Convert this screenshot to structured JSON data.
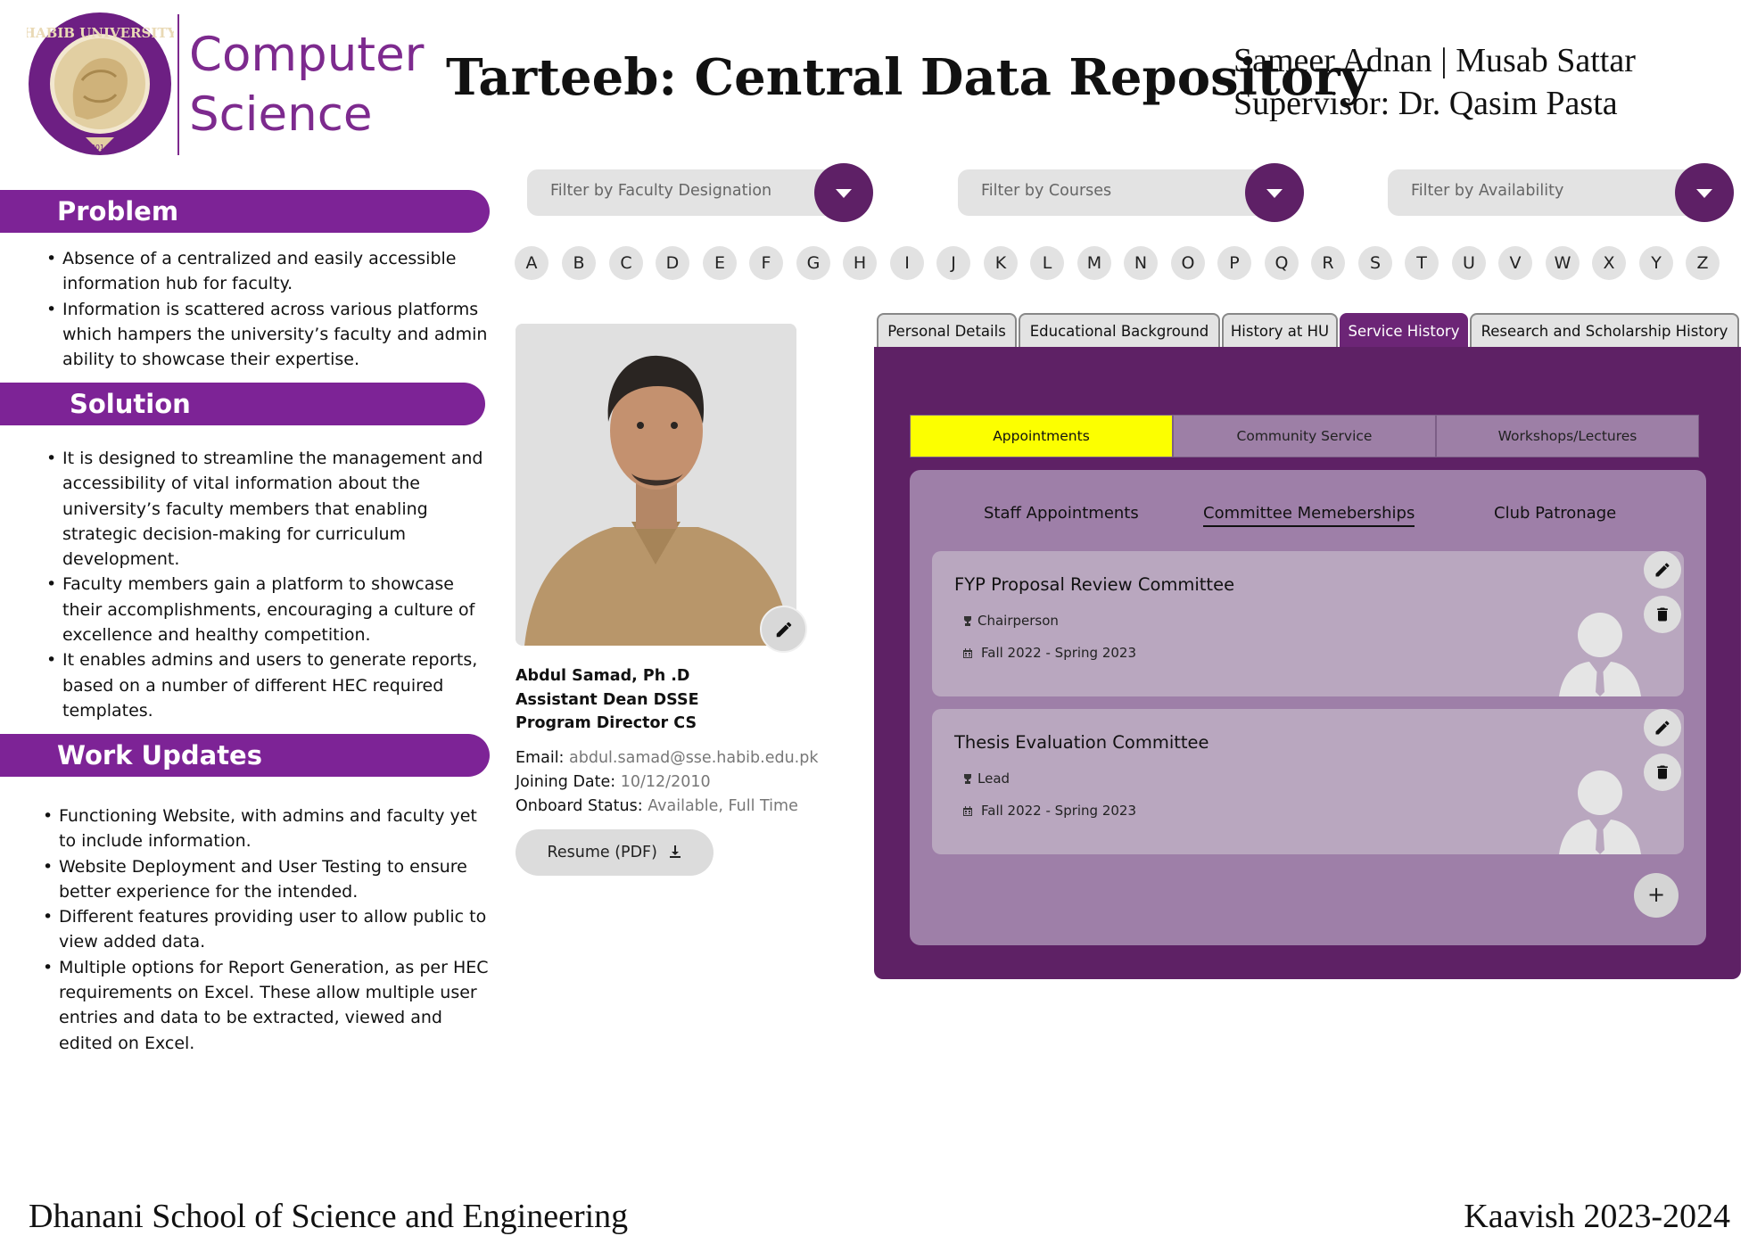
{
  "header": {
    "logo_text": "HABIB UNIVERSITY",
    "logo_year": "2014",
    "department_line1": "Computer",
    "department_line2": "Science",
    "title": "Tarteeb: Central Data Repository",
    "authors": "Sameer Adnan | Musab Sattar",
    "supervisor": "Supervisor: Dr. Qasim Pasta"
  },
  "sections": {
    "problem": {
      "title": "Problem",
      "bullets": [
        "Absence of a centralized and easily accessible information hub for faculty.",
        "Information is scattered across various platforms which hampers the university’s faculty and admin ability to showcase their expertise."
      ]
    },
    "solution": {
      "title": "Solution",
      "bullets": [
        "It is designed to streamline the management and accessibility of vital information about the university’s faculty members that enabling strategic decision-making for curriculum development.",
        "Faculty members gain a platform to showcase their accomplishments, encouraging a culture of excellence and healthy competition.",
        "It enables admins and users to generate reports, based on a number of different HEC required templates."
      ]
    },
    "work_updates": {
      "title": "Work Updates",
      "bullets": [
        "Functioning Website, with admins and faculty yet to include information.",
        "Website Deployment and User Testing to ensure better experience for the intended.",
        "Different features providing user to allow public to view added data.",
        "Multiple options for Report Generation, as per HEC requirements on Excel. These allow multiple user entries and data to be extracted, viewed and edited on Excel."
      ]
    }
  },
  "filters": {
    "designation": "Filter by Faculty Designation",
    "courses": "Filter by Courses",
    "availability": "Filter by Availability"
  },
  "alphabet": [
    "A",
    "B",
    "C",
    "D",
    "E",
    "F",
    "G",
    "H",
    "I",
    "J",
    "K",
    "L",
    "M",
    "N",
    "O",
    "P",
    "Q",
    "R",
    "S",
    "T",
    "U",
    "V",
    "W",
    "X",
    "Y",
    "Z"
  ],
  "profile": {
    "name": "Abdul Samad, Ph .D",
    "role1": "Assistant Dean DSSE",
    "role2": "Program Director CS",
    "email_label": "Email: ",
    "email": "abdul.samad@sse.habib.edu.pk",
    "joining_label": "Joining Date: ",
    "joining_date": "10/12/2010",
    "status_label": "Onboard Status: ",
    "status": "Available, Full Time",
    "resume_label": "Resume (PDF)"
  },
  "tabs": [
    "Personal Details",
    "Educational Background",
    "History at HU",
    "Service History",
    "Research and Scholarship History"
  ],
  "active_tab": "Service History",
  "subtabs": [
    "Appointments",
    "Community Service",
    "Workshops/Lectures"
  ],
  "active_subtab": "Appointments",
  "inner_tabs": [
    "Staff Appointments",
    "Committee Memeberships",
    "Club Patronage"
  ],
  "active_inner_tab": "Committee Memeberships",
  "committees": [
    {
      "title": "FYP Proposal Review Committee",
      "role": "Chairperson",
      "period": "Fall 2022 - Spring 2023"
    },
    {
      "title": "Thesis Evaluation Committee",
      "role": "Lead",
      "period": "Fall 2022 - Spring 2023"
    }
  ],
  "add_label": "+",
  "footer": {
    "school": "Dhanani School of Science and Engineering",
    "event": "Kaavish 2023-2024"
  },
  "colors": {
    "brand_purple": "#7d2396",
    "panel_purple": "#5e2165",
    "highlight_yellow": "#fcff00"
  }
}
